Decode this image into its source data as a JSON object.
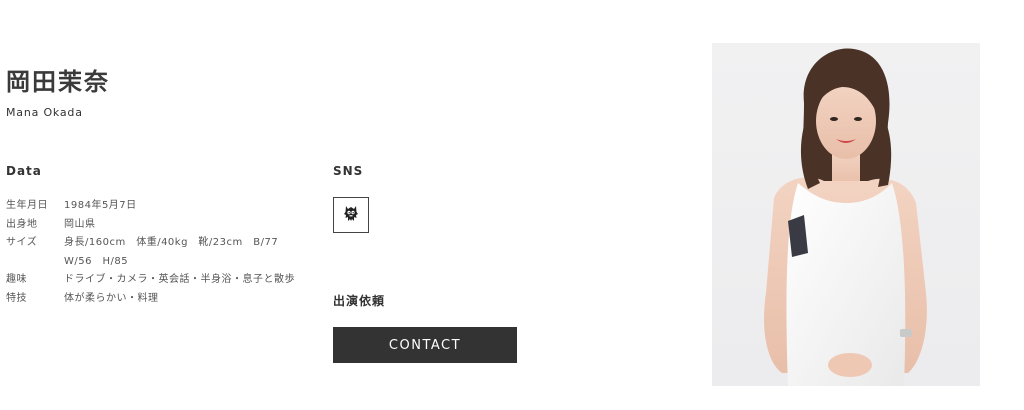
{
  "profile": {
    "name_jp": "岡田茉奈",
    "name_en": "Mana Okada"
  },
  "data_section": {
    "heading": "Data",
    "rows": [
      {
        "label": "生年月日",
        "value": "1984年5月7日"
      },
      {
        "label": "出身地",
        "value": "岡山県"
      },
      {
        "label": "サイズ",
        "value": "身長/160cm　体重/40kg　靴/23cm　B/77　W/56　H/85"
      },
      {
        "label": "趣味",
        "value": "ドライブ・カメラ・英会話・半身浴・息子と散歩"
      },
      {
        "label": "特技",
        "value": "体が柔らかい・料理"
      }
    ]
  },
  "sns_section": {
    "heading": "SNS",
    "icon": "ameba-blog-icon"
  },
  "offer_section": {
    "heading": "出演依頼",
    "contact_label": "CONTACT"
  },
  "colors": {
    "text": "#333333",
    "button_bg": "#333333",
    "button_text": "#ffffff"
  }
}
